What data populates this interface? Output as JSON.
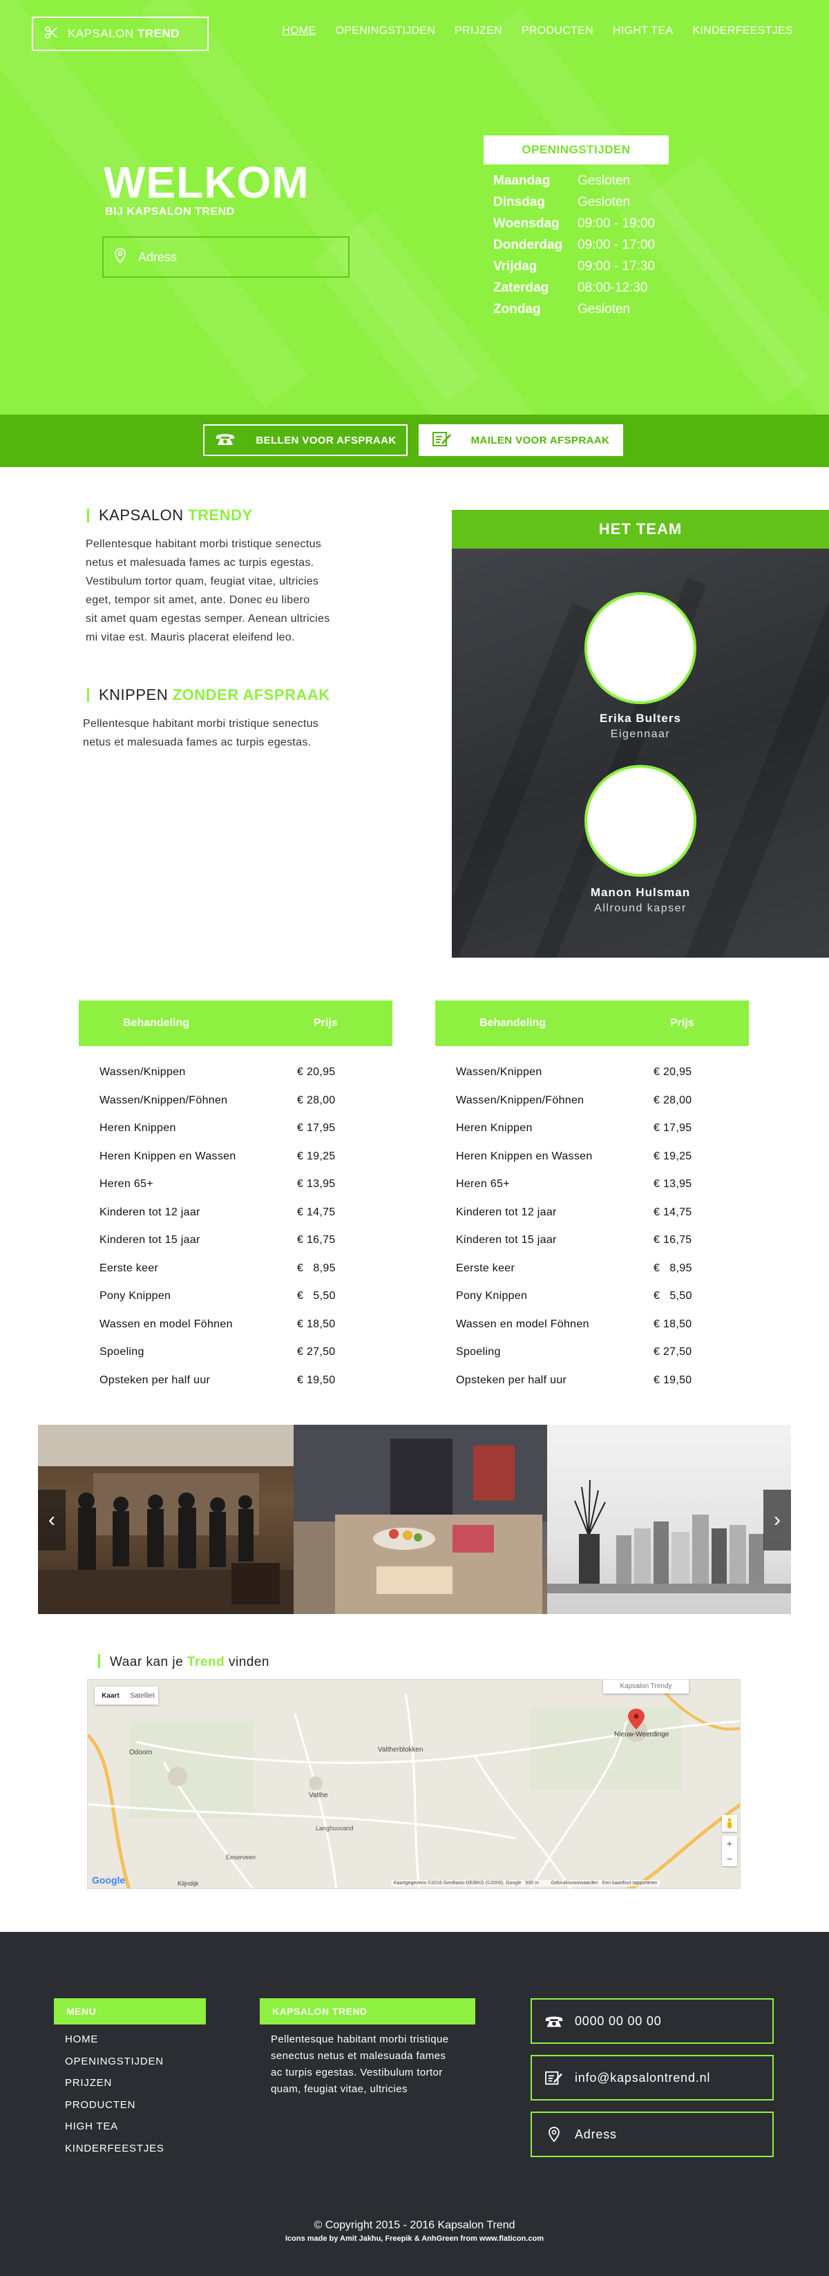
{
  "header": {
    "logo_text_1": "KAPSALON",
    "logo_text_2": "TREND",
    "nav": [
      {
        "label": "HOME"
      },
      {
        "label": "OPENINGSTIJDEN"
      },
      {
        "label": "PRIJZEN"
      },
      {
        "label": "PRODUCTEN"
      },
      {
        "label": "HIGHT TEA"
      },
      {
        "label": "KINDERFEESTJES"
      }
    ]
  },
  "hero": {
    "title": "WELKOM",
    "subtitle": "BIJ KAPSALON TREND",
    "address_label": "Adress",
    "hours_title": "OPENINGSTIJDEN",
    "hours": [
      {
        "day": "Maandag",
        "time": "Gesloten"
      },
      {
        "day": "Dinsdag",
        "time": "Gesloten"
      },
      {
        "day": "Woensdag",
        "time": "09:00 - 19:00"
      },
      {
        "day": "Donderdag",
        "time": "09:00 - 17:00"
      },
      {
        "day": "Vrijdag",
        "time": "09:00 - 17:30"
      },
      {
        "day": "Zaterdag",
        "time": "08:00-12:30"
      },
      {
        "day": "Zondag",
        "time": "Gesloten"
      }
    ]
  },
  "cta": {
    "call_label": "BELLEN VOOR AFSPRAAK",
    "mail_label": "MAILEN VOOR AFSPRAAK"
  },
  "about": {
    "title_1": "KAPSALON",
    "title_2": "TRENDY",
    "lines": [
      "Pellentesque habitant morbi tristique senectus",
      "netus et malesuada fames ac turpis egestas.",
      "Vestibulum tortor quam, feugiat vitae, ultricies",
      "eget, tempor sit amet, ante. Donec eu libero",
      "sit amet quam egestas semper. Aenean ultricies",
      "mi vitae est. Mauris placerat eleifend leo."
    ],
    "walkin_title_1": "KNIPPEN",
    "walkin_title_2": "ZONDER AFSPRAAK",
    "walkin_lines": [
      "Pellentesque habitant morbi tristique senectus",
      "netus et malesuada fames ac turpis egestas."
    ]
  },
  "team": {
    "title": "HET TEAM",
    "members": [
      {
        "name": "Erika Bulters",
        "role": "Eigennaar"
      },
      {
        "name": "Manon Hulsman",
        "role": "Allround kapser"
      }
    ]
  },
  "prices": {
    "col_treatment": "Behandeling",
    "col_price": "Prijs",
    "rows": [
      {
        "name": "Wassen/Knippen",
        "price": "€ 20,95"
      },
      {
        "name": "Wassen/Knippen/Föhnen",
        "price": "€ 28,00"
      },
      {
        "name": "Heren Knippen",
        "price": "€ 17,95"
      },
      {
        "name": "Heren Knippen en Wassen",
        "price": "€ 19,25"
      },
      {
        "name": "Heren 65+",
        "price": "€ 13,95"
      },
      {
        "name": "Kinderen tot 12 jaar",
        "price": "€ 14,75"
      },
      {
        "name": "Kinderen tot 15 jaar",
        "price": "€ 16,75"
      },
      {
        "name": "Eerste keer",
        "price": "€   8,95"
      },
      {
        "name": "Pony Knippen",
        "price": "€   5,50"
      },
      {
        "name": "Wassen en model Föhnen",
        "price": "€ 18,50"
      },
      {
        "name": "Spoeling",
        "price": "€ 27,50"
      },
      {
        "name": "Opsteken per half uur",
        "price": "€ 19,50"
      }
    ]
  },
  "map": {
    "title_1": "Waar kan je",
    "title_2": "Trend",
    "title_3": "vinden",
    "tab_map": "Kaart",
    "tab_sat": "Satelliet",
    "pin_label": "Kapsalon Trendy",
    "places": [
      "Valtherblokken",
      "Odoorn",
      "Valthe",
      "Nieuw-Weerdinge",
      "Klijndijk",
      "Langhuuvand",
      "Eeserveen"
    ],
    "google": "Google",
    "attribution": "Kaartgegevens ©2016 GeoBasis-DE/BKG (©2009), Google   500 m         Gebruiksvoorwaarden   Een kaartfout rapporteren"
  },
  "footer": {
    "menu_title": "MENU",
    "menu": [
      "HOME",
      "OPENINGSTIJDEN",
      "PRIJZEN",
      "PRODUCTEN",
      "HIGH TEA",
      "KINDERFEESTJES"
    ],
    "about_title": "KAPSALON TREND",
    "about_lines": [
      "Pellentesque habitant morbi tristique",
      "senectus netus et malesuada fames",
      "ac turpis egestas. Vestibulum tortor",
      "quam, feugiat vitae, ultricies"
    ],
    "phone": "0000 00 00 00",
    "email": "info@kapsalontrend.nl",
    "address": "Adress",
    "copyright": "© Copyright 2015 - 2016 Kapsalon Trend",
    "credits": "Icons made by Amit Jakhu, Freepik & AnhGreen from www.flaticon.com"
  },
  "colors": {
    "accent": "#8ef041",
    "accent_dark": "#55b50f",
    "footer": "#2b2d32"
  }
}
